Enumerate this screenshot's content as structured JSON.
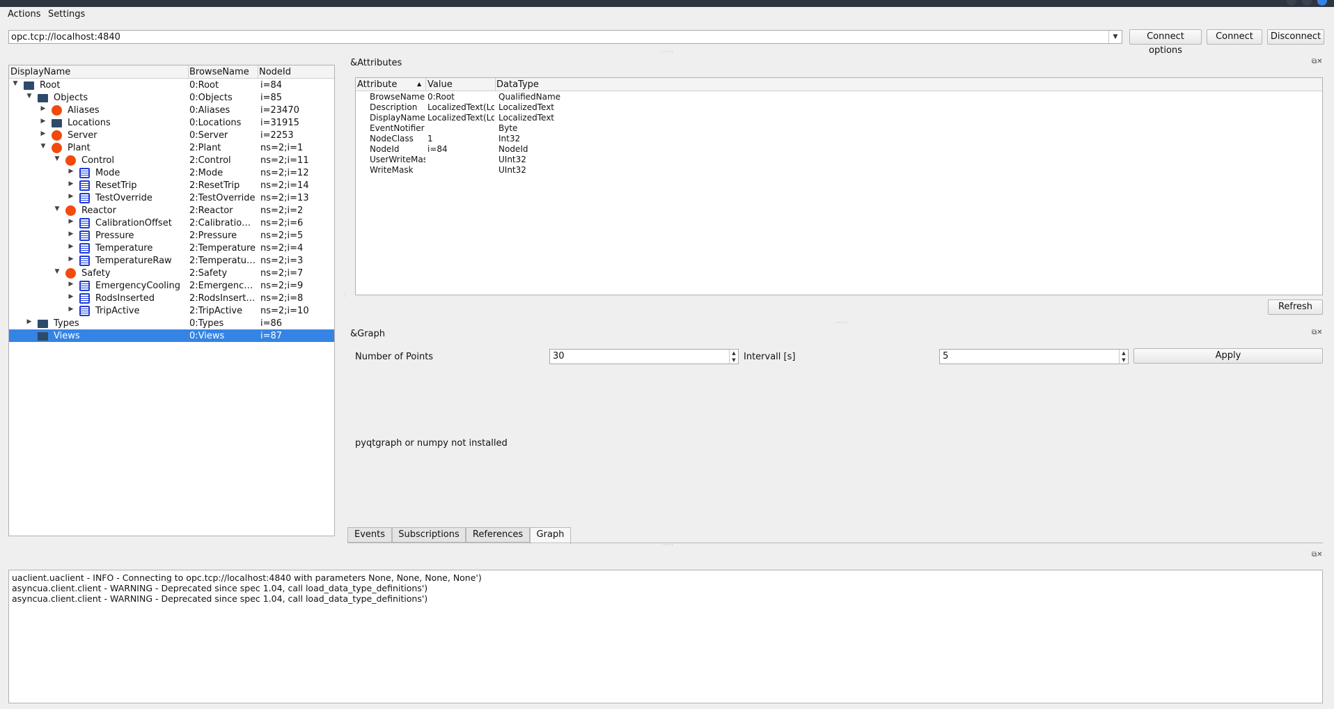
{
  "menu": {
    "actions": "Actions",
    "settings": "Settings"
  },
  "connection": {
    "url": "opc.tcp://localhost:4840",
    "connect_options": "Connect options",
    "connect": "Connect",
    "disconnect": "Disconnect"
  },
  "tree": {
    "headers": [
      "DisplayName",
      "BrowseName",
      "NodeId"
    ],
    "rows": [
      {
        "name": "Root",
        "browse": "0:Root",
        "id": "i=84",
        "depth": 0,
        "icon": "folder-icon",
        "expanded": true
      },
      {
        "name": "Objects",
        "browse": "0:Objects",
        "id": "i=85",
        "depth": 1,
        "icon": "folder-icon",
        "expanded": true
      },
      {
        "name": "Aliases",
        "browse": "0:Aliases",
        "id": "i=23470",
        "depth": 2,
        "icon": "object-icon",
        "expanded": false
      },
      {
        "name": "Locations",
        "browse": "0:Locations",
        "id": "i=31915",
        "depth": 2,
        "icon": "folder-icon",
        "expanded": false
      },
      {
        "name": "Server",
        "browse": "0:Server",
        "id": "i=2253",
        "depth": 2,
        "icon": "object-icon",
        "expanded": false
      },
      {
        "name": "Plant",
        "browse": "2:Plant",
        "id": "ns=2;i=1",
        "depth": 2,
        "icon": "object-icon",
        "expanded": true
      },
      {
        "name": "Control",
        "browse": "2:Control",
        "id": "ns=2;i=11",
        "depth": 3,
        "icon": "object-icon",
        "expanded": true
      },
      {
        "name": "Mode",
        "browse": "2:Mode",
        "id": "ns=2;i=12",
        "depth": 4,
        "icon": "variable-icon",
        "expanded": false
      },
      {
        "name": "ResetTrip",
        "browse": "2:ResetTrip",
        "id": "ns=2;i=14",
        "depth": 4,
        "icon": "variable-icon",
        "expanded": false
      },
      {
        "name": "TestOverride",
        "browse": "2:TestOverride",
        "id": "ns=2;i=13",
        "depth": 4,
        "icon": "variable-icon",
        "expanded": false
      },
      {
        "name": "Reactor",
        "browse": "2:Reactor",
        "id": "ns=2;i=2",
        "depth": 3,
        "icon": "object-icon",
        "expanded": true
      },
      {
        "name": "CalibrationOffset",
        "browse": "2:Calibration…",
        "id": "ns=2;i=6",
        "depth": 4,
        "icon": "variable-icon",
        "expanded": false
      },
      {
        "name": "Pressure",
        "browse": "2:Pressure",
        "id": "ns=2;i=5",
        "depth": 4,
        "icon": "variable-icon",
        "expanded": false
      },
      {
        "name": "Temperature",
        "browse": "2:Temperature",
        "id": "ns=2;i=4",
        "depth": 4,
        "icon": "variable-icon",
        "expanded": false
      },
      {
        "name": "TemperatureRaw",
        "browse": "2:Temperatur…",
        "id": "ns=2;i=3",
        "depth": 4,
        "icon": "variable-icon",
        "expanded": false
      },
      {
        "name": "Safety",
        "browse": "2:Safety",
        "id": "ns=2;i=7",
        "depth": 3,
        "icon": "object-icon",
        "expanded": true
      },
      {
        "name": "EmergencyCooling",
        "browse": "2:Emergency…",
        "id": "ns=2;i=9",
        "depth": 4,
        "icon": "variable-icon",
        "expanded": false
      },
      {
        "name": "RodsInserted",
        "browse": "2:RodsInserted",
        "id": "ns=2;i=8",
        "depth": 4,
        "icon": "variable-icon",
        "expanded": false
      },
      {
        "name": "TripActive",
        "browse": "2:TripActive",
        "id": "ns=2;i=10",
        "depth": 4,
        "icon": "variable-icon",
        "expanded": false
      },
      {
        "name": "Types",
        "browse": "0:Types",
        "id": "i=86",
        "depth": 1,
        "icon": "folder-icon",
        "expanded": false
      },
      {
        "name": "Views",
        "browse": "0:Views",
        "id": "i=87",
        "depth": 1,
        "icon": "folder-icon",
        "expanded": false,
        "selected": true
      }
    ]
  },
  "attributes": {
    "title": "&Attributes",
    "headers": [
      "Attribute",
      "Value",
      "DataType"
    ],
    "rows": [
      {
        "attr": "BrowseName",
        "value": "0:Root",
        "type": "QualifiedName"
      },
      {
        "attr": "Description",
        "value": "LocalizedText(Lo",
        "type": "LocalizedText"
      },
      {
        "attr": "DisplayName",
        "value": "LocalizedText(Lo",
        "type": "LocalizedText"
      },
      {
        "attr": "EventNotifier",
        "value": "",
        "type": "Byte"
      },
      {
        "attr": "NodeClass",
        "value": "1",
        "type": "Int32"
      },
      {
        "attr": "NodeId",
        "value": "i=84",
        "type": "NodeId"
      },
      {
        "attr": "UserWriteMas",
        "value": "",
        "type": "UInt32"
      },
      {
        "attr": "WriteMask",
        "value": "",
        "type": "UInt32"
      }
    ],
    "refresh": "Refresh"
  },
  "graph": {
    "title": "&Graph",
    "points_label": "Number of Points",
    "points_value": "30",
    "interval_label": "Intervall [s]",
    "interval_value": "5",
    "apply": "Apply",
    "message": "pyqtgraph or numpy not installed"
  },
  "tabs": [
    "Events",
    "Subscriptions",
    "References",
    "Graph"
  ],
  "log": [
    "uaclient.uaclient - INFO - Connecting to opc.tcp://localhost:4840 with parameters None, None, None, None')",
    "asyncua.client.client - WARNING - Deprecated since spec 1.04, call load_data_type_definitions')",
    "asyncua.client.client - WARNING - Deprecated since spec 1.04, call load_data_type_definitions')"
  ]
}
